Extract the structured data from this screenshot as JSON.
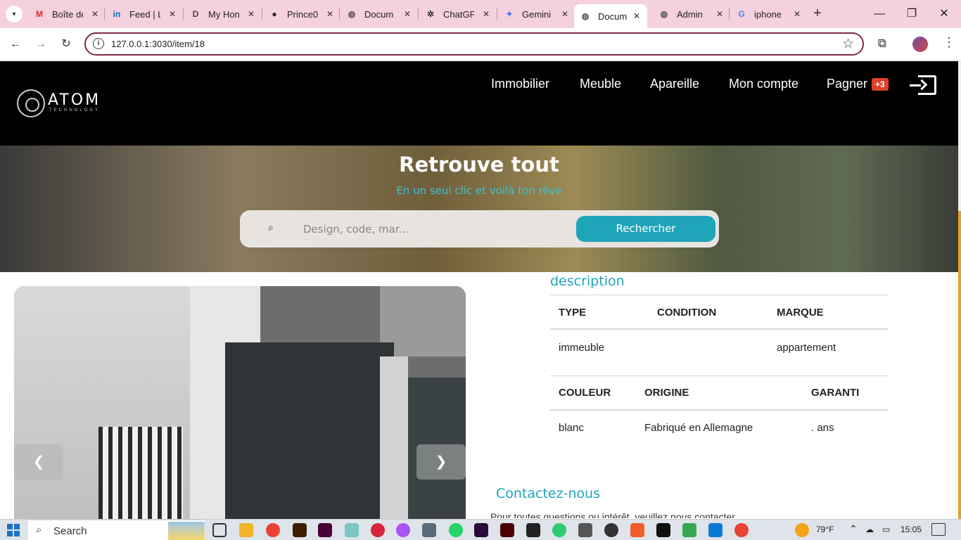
{
  "browser": {
    "tabs": [
      {
        "label": "Boîte de",
        "icon": "gmail-icon",
        "color": "#d93025",
        "glyph": "M"
      },
      {
        "label": "Feed | L",
        "icon": "linkedin-icon",
        "color": "#0a66c2",
        "glyph": "in"
      },
      {
        "label": "My Hon",
        "icon": "document-icon",
        "color": "#444444",
        "glyph": "D"
      },
      {
        "label": "Prince0",
        "icon": "github-icon",
        "color": "#222222",
        "glyph": "●"
      },
      {
        "label": "Docum",
        "icon": "globe-icon",
        "color": "#555555",
        "glyph": "◍"
      },
      {
        "label": "ChatGP",
        "icon": "chatgpt-icon",
        "color": "#333333",
        "glyph": "✲"
      },
      {
        "label": "Gemini",
        "icon": "gemini-icon",
        "color": "#3b7cf4",
        "glyph": "✦"
      },
      {
        "label": "Docum",
        "icon": "globe-icon",
        "color": "#555555",
        "glyph": "◍",
        "active": true
      },
      {
        "label": "Admin",
        "icon": "globe-icon",
        "color": "#555555",
        "glyph": "◍"
      },
      {
        "label": "iphone",
        "icon": "google-icon",
        "color": "#4285f4",
        "glyph": "G"
      }
    ],
    "url": "127.0.0.1:3030/item/18"
  },
  "site": {
    "logo_text": "ATOM",
    "logo_sub": "TECHNOLOGY",
    "nav": [
      "Immobilier",
      "Meuble",
      "Apareille",
      "Mon compte",
      "Pagner"
    ],
    "cart_badge": "+3"
  },
  "hero": {
    "title": "Retrouve tout",
    "subtitle": "En un seul clic et voilà ton rêve",
    "search_placeholder": "Design, code, mar...",
    "search_button": "Rechercher"
  },
  "product": {
    "description_title": "description",
    "table1": {
      "headers": [
        "TYPE",
        "CONDITION",
        "MARQUE"
      ],
      "values": [
        "immeuble",
        "",
        "appartement"
      ]
    },
    "table2": {
      "headers": [
        "COULEUR",
        "ORIGINE",
        "GARANTI"
      ],
      "values": [
        "blanc",
        "Fabriqué en Allemagne",
        ". ans"
      ]
    },
    "contact_title": "Contactez-nous",
    "contact_text": "Pour toutes questions ou intérêt, veuillez nous contacter"
  },
  "taskbar": {
    "search_label": "Search",
    "temperature": "79°F",
    "time": "15:05"
  },
  "colors": {
    "accent": "#1fa5ba",
    "tabbar": "#f5d0de",
    "badge": "#e0402a"
  }
}
